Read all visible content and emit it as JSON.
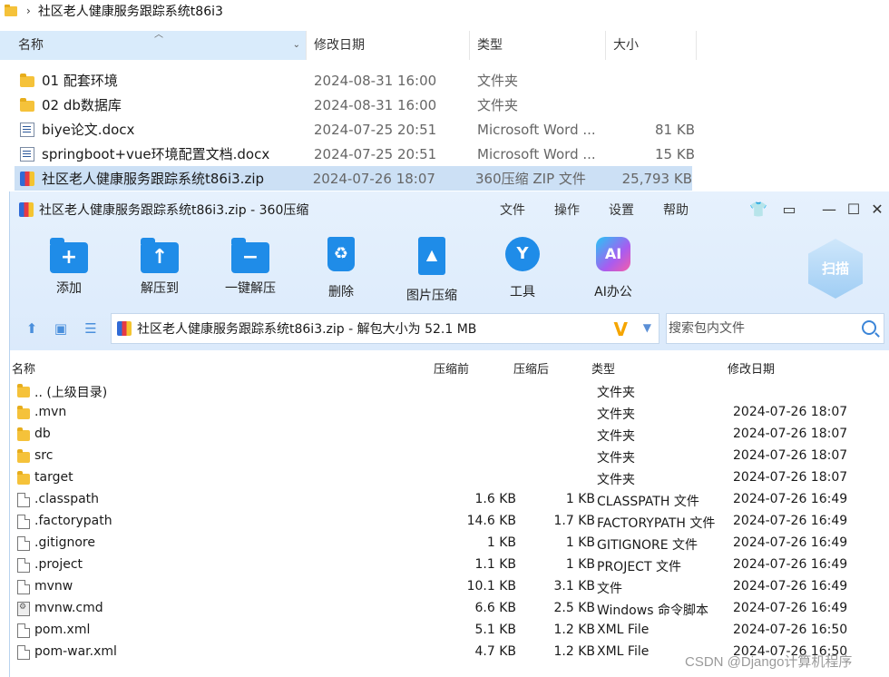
{
  "explorer": {
    "path": "社区老人健康服务跟踪系统t86i3",
    "headers": {
      "name": "名称",
      "date": "修改日期",
      "type": "类型",
      "size": "大小"
    },
    "rows": [
      {
        "icon": "folder-icon",
        "name": "01 配套环境",
        "date": "2024-08-31 16:00",
        "type": "文件夹",
        "size": ""
      },
      {
        "icon": "folder-icon",
        "name": "02 db数据库",
        "date": "2024-08-31 16:00",
        "type": "文件夹",
        "size": ""
      },
      {
        "icon": "word-doc-icon",
        "name": "biye论文.docx",
        "date": "2024-07-25 20:51",
        "type": "Microsoft Word ...",
        "size": "81 KB"
      },
      {
        "icon": "word-doc-icon",
        "name": "springboot+vue环境配置文档.docx",
        "date": "2024-07-25 20:51",
        "type": "Microsoft Word ...",
        "size": "15 KB"
      },
      {
        "icon": "zip-archive-icon",
        "name": "社区老人健康服务跟踪系统t86i3.zip",
        "date": "2024-07-26 18:07",
        "type": "360压缩 ZIP 文件",
        "size": "25,793 KB",
        "selected": true
      }
    ]
  },
  "zip": {
    "title": "社区老人健康服务跟踪系统t86i3.zip - 360压缩",
    "menu": [
      "文件",
      "操作",
      "设置",
      "帮助"
    ],
    "toolbar": [
      {
        "label": "添加",
        "icon": "add-icon"
      },
      {
        "label": "解压到",
        "icon": "extract-to-icon"
      },
      {
        "label": "一键解压",
        "icon": "one-click-extract-icon"
      },
      {
        "label": "删除",
        "icon": "delete-icon"
      },
      {
        "label": "图片压缩",
        "icon": "image-compress-icon"
      },
      {
        "label": "工具",
        "icon": "tools-icon"
      },
      {
        "label": "AI办公",
        "icon": "ai-office-icon"
      }
    ],
    "scan_label": "扫描",
    "address": "社区老人健康服务跟踪系统t86i3.zip - 解包大小为 52.1 MB",
    "search_placeholder": "搜索包内文件",
    "headers": {
      "name": "名称",
      "before": "压缩前",
      "after": "压缩后",
      "type": "类型",
      "date": "修改日期"
    },
    "files": [
      {
        "icon": "folder-icon",
        "name": ".. (上级目录)",
        "before": "",
        "after": "",
        "type": "文件夹",
        "date": ""
      },
      {
        "icon": "folder-icon",
        "name": ".mvn",
        "before": "",
        "after": "",
        "type": "文件夹",
        "date": "2024-07-26 18:07"
      },
      {
        "icon": "folder-icon",
        "name": "db",
        "before": "",
        "after": "",
        "type": "文件夹",
        "date": "2024-07-26 18:07"
      },
      {
        "icon": "folder-icon",
        "name": "src",
        "before": "",
        "after": "",
        "type": "文件夹",
        "date": "2024-07-26 18:07"
      },
      {
        "icon": "folder-icon",
        "name": "target",
        "before": "",
        "after": "",
        "type": "文件夹",
        "date": "2024-07-26 18:07"
      },
      {
        "icon": "file-icon",
        "name": ".classpath",
        "before": "1.6 KB",
        "after": "1 KB",
        "type": "CLASSPATH 文件",
        "date": "2024-07-26 16:49"
      },
      {
        "icon": "file-icon",
        "name": ".factorypath",
        "before": "14.6 KB",
        "after": "1.7 KB",
        "type": "FACTORYPATH 文件",
        "date": "2024-07-26 16:49"
      },
      {
        "icon": "file-icon",
        "name": ".gitignore",
        "before": "1 KB",
        "after": "1 KB",
        "type": "GITIGNORE 文件",
        "date": "2024-07-26 16:49"
      },
      {
        "icon": "file-icon",
        "name": ".project",
        "before": "1.1 KB",
        "after": "1 KB",
        "type": "PROJECT 文件",
        "date": "2024-07-26 16:49"
      },
      {
        "icon": "file-icon",
        "name": "mvnw",
        "before": "10.1 KB",
        "after": "3.1 KB",
        "type": "文件",
        "date": "2024-07-26 16:49"
      },
      {
        "icon": "cmd-script-icon",
        "name": "mvnw.cmd",
        "before": "6.6 KB",
        "after": "2.5 KB",
        "type": "Windows 命令脚本",
        "date": "2024-07-26 16:49"
      },
      {
        "icon": "file-icon",
        "name": "pom.xml",
        "before": "5.1 KB",
        "after": "1.2 KB",
        "type": "XML File",
        "date": "2024-07-26 16:50"
      },
      {
        "icon": "file-icon",
        "name": "pom-war.xml",
        "before": "4.7 KB",
        "after": "1.2 KB",
        "type": "XML File",
        "date": "2024-07-26 16:50"
      }
    ]
  },
  "watermark": "CSDN @Django计算机程序"
}
